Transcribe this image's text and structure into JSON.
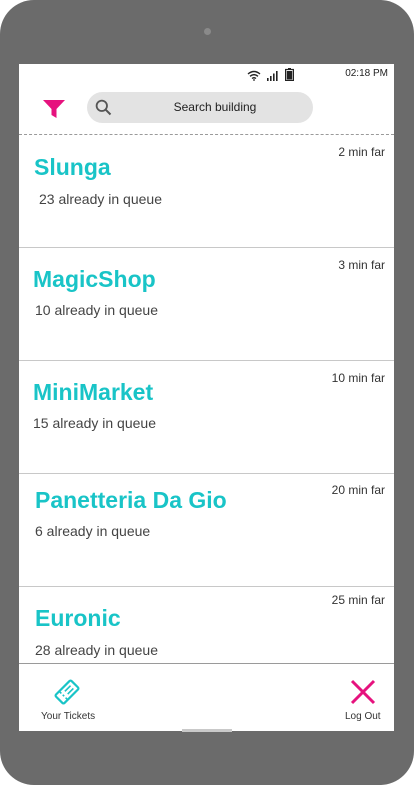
{
  "status": {
    "time": "02:18 PM",
    "icons": [
      "wifi-icon",
      "signal-icon",
      "battery-icon"
    ]
  },
  "header": {
    "filter_icon": "filter-icon",
    "search_placeholder": "Search building"
  },
  "buildings": [
    {
      "name": "Slunga",
      "queue": "23 already in queue",
      "distance": "2 min far"
    },
    {
      "name": "MagicShop",
      "queue": "10 already in queue",
      "distance": "3 min far"
    },
    {
      "name": "MiniMarket",
      "queue": "15 already in queue",
      "distance": "10 min far"
    },
    {
      "name": "Panetteria Da Gio",
      "queue": "6 already in queue",
      "distance": "20 min far"
    },
    {
      "name": "Euronic",
      "queue": "28 already in queue",
      "distance": "25 min far"
    }
  ],
  "bottom_nav": {
    "tickets_label": "Your Tickets",
    "logout_label": "Log Out"
  },
  "colors": {
    "accent": "#19c4c7",
    "brand_pink": "#e6127e"
  }
}
